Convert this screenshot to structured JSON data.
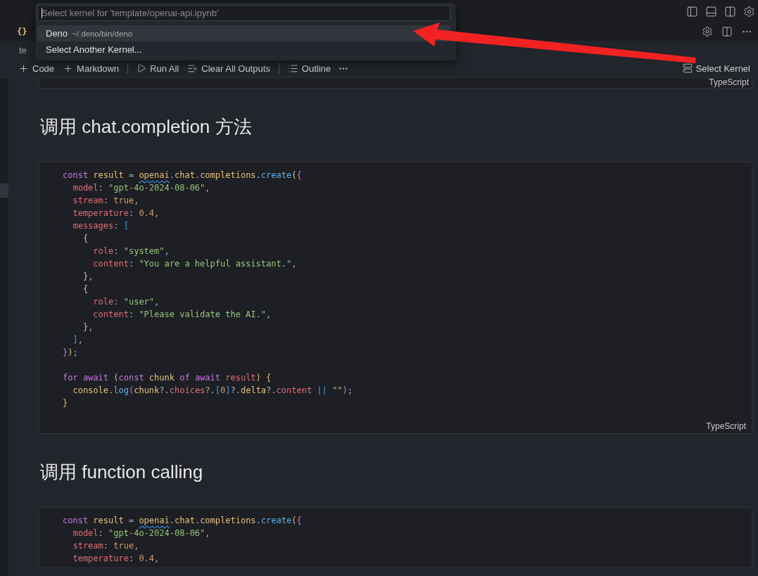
{
  "file_tab": {
    "icon_text": "{}"
  },
  "breadcrumb": "te",
  "toolbar": {
    "items": [
      {
        "kind": "add",
        "label": "Code"
      },
      {
        "kind": "add",
        "label": "Markdown"
      },
      {
        "kind": "separator"
      },
      {
        "kind": "run",
        "label": "Run All"
      },
      {
        "kind": "clear",
        "label": "Clear All Outputs"
      },
      {
        "kind": "separator"
      },
      {
        "kind": "outline",
        "label": "Outline"
      },
      {
        "kind": "more"
      }
    ],
    "kernel": "Select Kernel"
  },
  "quick_pick": {
    "placeholder": "Select kernel for 'template/openai-api.ipynb'",
    "items": [
      {
        "label": "Deno",
        "description": "~/.deno/bin/deno",
        "selected": true
      },
      {
        "label": "Select Another Kernel...",
        "selected": false
      }
    ]
  },
  "cells": [
    {
      "kind": "output_tail",
      "language": "TypeScript"
    },
    {
      "kind": "markdown",
      "heading": "调用 chat.completion 方法"
    },
    {
      "kind": "code",
      "language": "TypeScript",
      "blocks": [
        [
          [
            {
              "kind": "keyword",
              "text": "const "
            },
            {
              "kind": "variable",
              "text": "result "
            },
            {
              "kind": "punct",
              "text": "= "
            },
            {
              "kind": "warning",
              "text": "openai"
            },
            {
              "kind": "punct",
              "text": "."
            },
            {
              "kind": "variable",
              "text": "chat"
            },
            {
              "kind": "punct",
              "text": "."
            },
            {
              "kind": "variable",
              "text": "completions"
            },
            {
              "kind": "punct",
              "text": "."
            },
            {
              "kind": "function",
              "text": "create"
            },
            {
              "kind": "bracket1",
              "text": "("
            },
            {
              "kind": "bracket2",
              "text": "{"
            }
          ],
          [
            {
              "kind": "property",
              "text": "  model"
            },
            {
              "kind": "punct",
              "text": ": "
            },
            {
              "kind": "string",
              "text": "\"gpt-4o-2024-08-06\""
            },
            {
              "kind": "punct",
              "text": ","
            }
          ],
          [
            {
              "kind": "property",
              "text": "  stream"
            },
            {
              "kind": "punct",
              "text": ": "
            },
            {
              "kind": "number",
              "text": "true"
            },
            {
              "kind": "punct",
              "text": ","
            }
          ],
          [
            {
              "kind": "property",
              "text": "  temperature"
            },
            {
              "kind": "punct",
              "text": ": "
            },
            {
              "kind": "number",
              "text": "0.4"
            },
            {
              "kind": "punct",
              "text": ","
            }
          ],
          [
            {
              "kind": "property",
              "text": "  messages"
            },
            {
              "kind": "punct",
              "text": ": "
            },
            {
              "kind": "bracket3",
              "text": "["
            }
          ],
          [
            {
              "kind": "bracket1",
              "text": "    {"
            }
          ],
          [
            {
              "kind": "property",
              "text": "      role"
            },
            {
              "kind": "punct",
              "text": ": "
            },
            {
              "kind": "string",
              "text": "\"system\""
            },
            {
              "kind": "punct",
              "text": ","
            }
          ],
          [
            {
              "kind": "property",
              "text": "      content"
            },
            {
              "kind": "punct",
              "text": ": "
            },
            {
              "kind": "string",
              "text": "\"You are a helpful assistant.\""
            },
            {
              "kind": "punct",
              "text": ","
            }
          ],
          [
            {
              "kind": "bracket1",
              "text": "    }"
            },
            {
              "kind": "punct",
              "text": ","
            }
          ],
          [
            {
              "kind": "bracket1",
              "text": "    {"
            }
          ],
          [
            {
              "kind": "property",
              "text": "      role"
            },
            {
              "kind": "punct",
              "text": ": "
            },
            {
              "kind": "string",
              "text": "\"user\""
            },
            {
              "kind": "punct",
              "text": ","
            }
          ],
          [
            {
              "kind": "property",
              "text": "      content"
            },
            {
              "kind": "punct",
              "text": ": "
            },
            {
              "kind": "string",
              "text": "\"Please validate the AI.\""
            },
            {
              "kind": "punct",
              "text": ","
            }
          ],
          [
            {
              "kind": "bracket1",
              "text": "    }"
            },
            {
              "kind": "punct",
              "text": ","
            }
          ],
          [
            {
              "kind": "bracket3",
              "text": "  ]"
            },
            {
              "kind": "punct",
              "text": ","
            }
          ],
          [
            {
              "kind": "bracket2",
              "text": "}"
            },
            {
              "kind": "bracket1",
              "text": ")"
            },
            {
              "kind": "punct",
              "text": ";"
            }
          ]
        ],
        [
          [
            {
              "kind": "keyword",
              "text": "for await "
            },
            {
              "kind": "bracket1",
              "text": "("
            },
            {
              "kind": "keyword",
              "text": "const "
            },
            {
              "kind": "variable",
              "text": "chunk "
            },
            {
              "kind": "keyword",
              "text": "of await "
            },
            {
              "kind": "property",
              "text": "result"
            },
            {
              "kind": "bracket1",
              "text": ") {"
            }
          ],
          [
            {
              "kind": "variable",
              "text": "  console"
            },
            {
              "kind": "punct",
              "text": "."
            },
            {
              "kind": "function",
              "text": "log"
            },
            {
              "kind": "bracket2",
              "text": "("
            },
            {
              "kind": "variable",
              "text": "chunk"
            },
            {
              "kind": "punct",
              "text": "?."
            },
            {
              "kind": "property",
              "text": "choices"
            },
            {
              "kind": "punct",
              "text": "?."
            },
            {
              "kind": "bracket3",
              "text": "["
            },
            {
              "kind": "number",
              "text": "0"
            },
            {
              "kind": "bracket3",
              "text": "]"
            },
            {
              "kind": "punct",
              "text": "?."
            },
            {
              "kind": "variable",
              "text": "delta"
            },
            {
              "kind": "punct",
              "text": "?."
            },
            {
              "kind": "property",
              "text": "content "
            },
            {
              "kind": "bracket3",
              "text": "|| "
            },
            {
              "kind": "string",
              "text": "\"\""
            },
            {
              "kind": "bracket2",
              "text": ")"
            },
            {
              "kind": "punct",
              "text": ";"
            }
          ],
          [
            {
              "kind": "bracket1",
              "text": "}"
            }
          ]
        ]
      ]
    },
    {
      "kind": "markdown",
      "heading": "调用 function calling"
    },
    {
      "kind": "code",
      "blocks": [
        [
          [
            {
              "kind": "keyword",
              "text": "const "
            },
            {
              "kind": "variable",
              "text": "result "
            },
            {
              "kind": "punct",
              "text": "= "
            },
            {
              "kind": "warning",
              "text": "openai"
            },
            {
              "kind": "punct",
              "text": "."
            },
            {
              "kind": "variable",
              "text": "chat"
            },
            {
              "kind": "punct",
              "text": "."
            },
            {
              "kind": "variable",
              "text": "completions"
            },
            {
              "kind": "punct",
              "text": "."
            },
            {
              "kind": "function",
              "text": "create"
            },
            {
              "kind": "bracket1",
              "text": "("
            },
            {
              "kind": "bracket2",
              "text": "{"
            }
          ],
          [
            {
              "kind": "property",
              "text": "  model"
            },
            {
              "kind": "punct",
              "text": ": "
            },
            {
              "kind": "string",
              "text": "\"gpt-4o-2024-08-06\""
            },
            {
              "kind": "punct",
              "text": ","
            }
          ],
          [
            {
              "kind": "property",
              "text": "  stream"
            },
            {
              "kind": "punct",
              "text": ": "
            },
            {
              "kind": "number",
              "text": "true"
            },
            {
              "kind": "punct",
              "text": ","
            }
          ],
          [
            {
              "kind": "property",
              "text": "  temperature"
            },
            {
              "kind": "punct",
              "text": ": "
            },
            {
              "kind": "number",
              "text": "0.4"
            },
            {
              "kind": "punct",
              "text": ","
            }
          ]
        ]
      ]
    }
  ]
}
